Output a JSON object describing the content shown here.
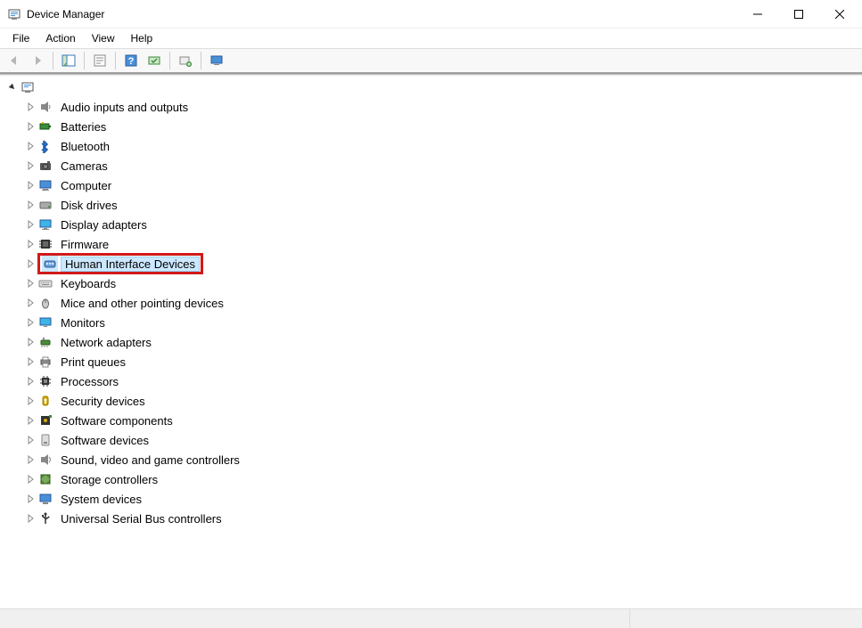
{
  "window": {
    "title": "Device Manager"
  },
  "menu": {
    "file": "File",
    "action": "Action",
    "view": "View",
    "help": "Help"
  },
  "toolbar": {
    "back": "Back",
    "forward": "Forward",
    "show_hide_tree": "Show/Hide Console Tree",
    "properties": "Properties",
    "help": "Help",
    "refresh": "Scan for hardware changes",
    "add_legacy": "Add legacy hardware",
    "remote": "Connect to remote"
  },
  "tree": {
    "root_label": "",
    "items": [
      {
        "label": "Audio inputs and outputs",
        "icon": "speaker"
      },
      {
        "label": "Batteries",
        "icon": "battery"
      },
      {
        "label": "Bluetooth",
        "icon": "bluetooth"
      },
      {
        "label": "Cameras",
        "icon": "camera"
      },
      {
        "label": "Computer",
        "icon": "computer"
      },
      {
        "label": "Disk drives",
        "icon": "disk"
      },
      {
        "label": "Display adapters",
        "icon": "display"
      },
      {
        "label": "Firmware",
        "icon": "firmware"
      },
      {
        "label": "Human Interface Devices",
        "icon": "hid",
        "selected": true,
        "highlighted": true
      },
      {
        "label": "Keyboards",
        "icon": "keyboard"
      },
      {
        "label": "Mice and other pointing devices",
        "icon": "mouse"
      },
      {
        "label": "Monitors",
        "icon": "monitor"
      },
      {
        "label": "Network adapters",
        "icon": "network"
      },
      {
        "label": "Print queues",
        "icon": "printer"
      },
      {
        "label": "Processors",
        "icon": "cpu"
      },
      {
        "label": "Security devices",
        "icon": "security"
      },
      {
        "label": "Software components",
        "icon": "software-comp"
      },
      {
        "label": "Software devices",
        "icon": "software-dev"
      },
      {
        "label": "Sound, video and game controllers",
        "icon": "sound"
      },
      {
        "label": "Storage controllers",
        "icon": "storage"
      },
      {
        "label": "System devices",
        "icon": "system"
      },
      {
        "label": "Universal Serial Bus controllers",
        "icon": "usb"
      }
    ]
  }
}
